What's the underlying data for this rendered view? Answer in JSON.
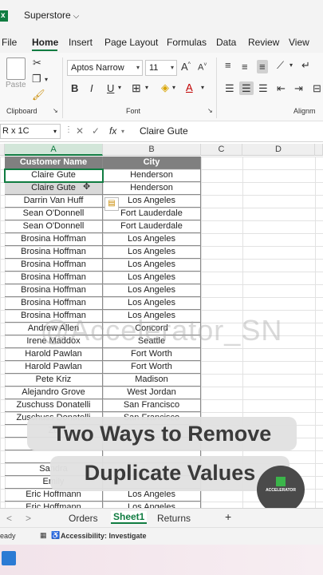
{
  "window": {
    "title": "Superstore"
  },
  "menu": [
    "File",
    "Home",
    "Insert",
    "Page Layout",
    "Formulas",
    "Data",
    "Review",
    "View"
  ],
  "ribbon": {
    "paste_label": "Paste",
    "clipboard_label": "Clipboard",
    "font_label": "Font",
    "alignment_label": "Alignm",
    "font_name": "Aptos Narrow",
    "font_size": "11",
    "bold": "B",
    "italic": "I",
    "underline": "U"
  },
  "formula_bar": {
    "name_box": "R x 1C",
    "fx": "fx",
    "value": "Claire Gute"
  },
  "columns": [
    "A",
    "B",
    "C",
    "D"
  ],
  "table": {
    "headers": [
      "Customer Name",
      "City"
    ],
    "rows": [
      [
        "Claire Gute",
        "Henderson"
      ],
      [
        "Claire Gute",
        "Henderson"
      ],
      [
        "Darrin Van Huff",
        "Los Angeles"
      ],
      [
        "Sean O'Donnell",
        "Fort Lauderdale"
      ],
      [
        "Sean O'Donnell",
        "Fort Lauderdale"
      ],
      [
        "Brosina Hoffman",
        "Los Angeles"
      ],
      [
        "Brosina Hoffman",
        "Los Angeles"
      ],
      [
        "Brosina Hoffman",
        "Los Angeles"
      ],
      [
        "Brosina Hoffman",
        "Los Angeles"
      ],
      [
        "Brosina Hoffman",
        "Los Angeles"
      ],
      [
        "Brosina Hoffman",
        "Los Angeles"
      ],
      [
        "Brosina Hoffman",
        "Los Angeles"
      ],
      [
        "Andrew Allen",
        "Concord"
      ],
      [
        "Irene Maddox",
        "Seattle"
      ],
      [
        "Harold Pawlan",
        "Fort Worth"
      ],
      [
        "Harold Pawlan",
        "Fort Worth"
      ],
      [
        "Pete Kriz",
        "Madison"
      ],
      [
        "Alejandro Grove",
        "West Jordan"
      ],
      [
        "Zuschuss Donatelli",
        "San Francisco"
      ],
      [
        "Zuschuss Donatelli",
        "San Francisco"
      ],
      [
        "Zu",
        ""
      ],
      [
        "",
        ""
      ],
      [
        "",
        ""
      ],
      [
        "Sandra",
        ""
      ],
      [
        "Emily",
        ""
      ],
      [
        "Eric Hoffmann",
        "Los Angeles"
      ],
      [
        "Eric Hoffmann",
        "Los Angeles"
      ]
    ]
  },
  "watermark": "@Accelerator_SN",
  "banner": {
    "line1": "Two Ways to Remove",
    "line2": "Duplicate Values"
  },
  "logo_text": "ACCELERATOR",
  "sheets": [
    "Orders",
    "Sheet1",
    "Returns"
  ],
  "sheet_nav": {
    "prev": "<",
    "next": ">",
    "add": "+"
  },
  "status": {
    "ready": "eady",
    "accessibility": "Accessibility: Investigate"
  }
}
